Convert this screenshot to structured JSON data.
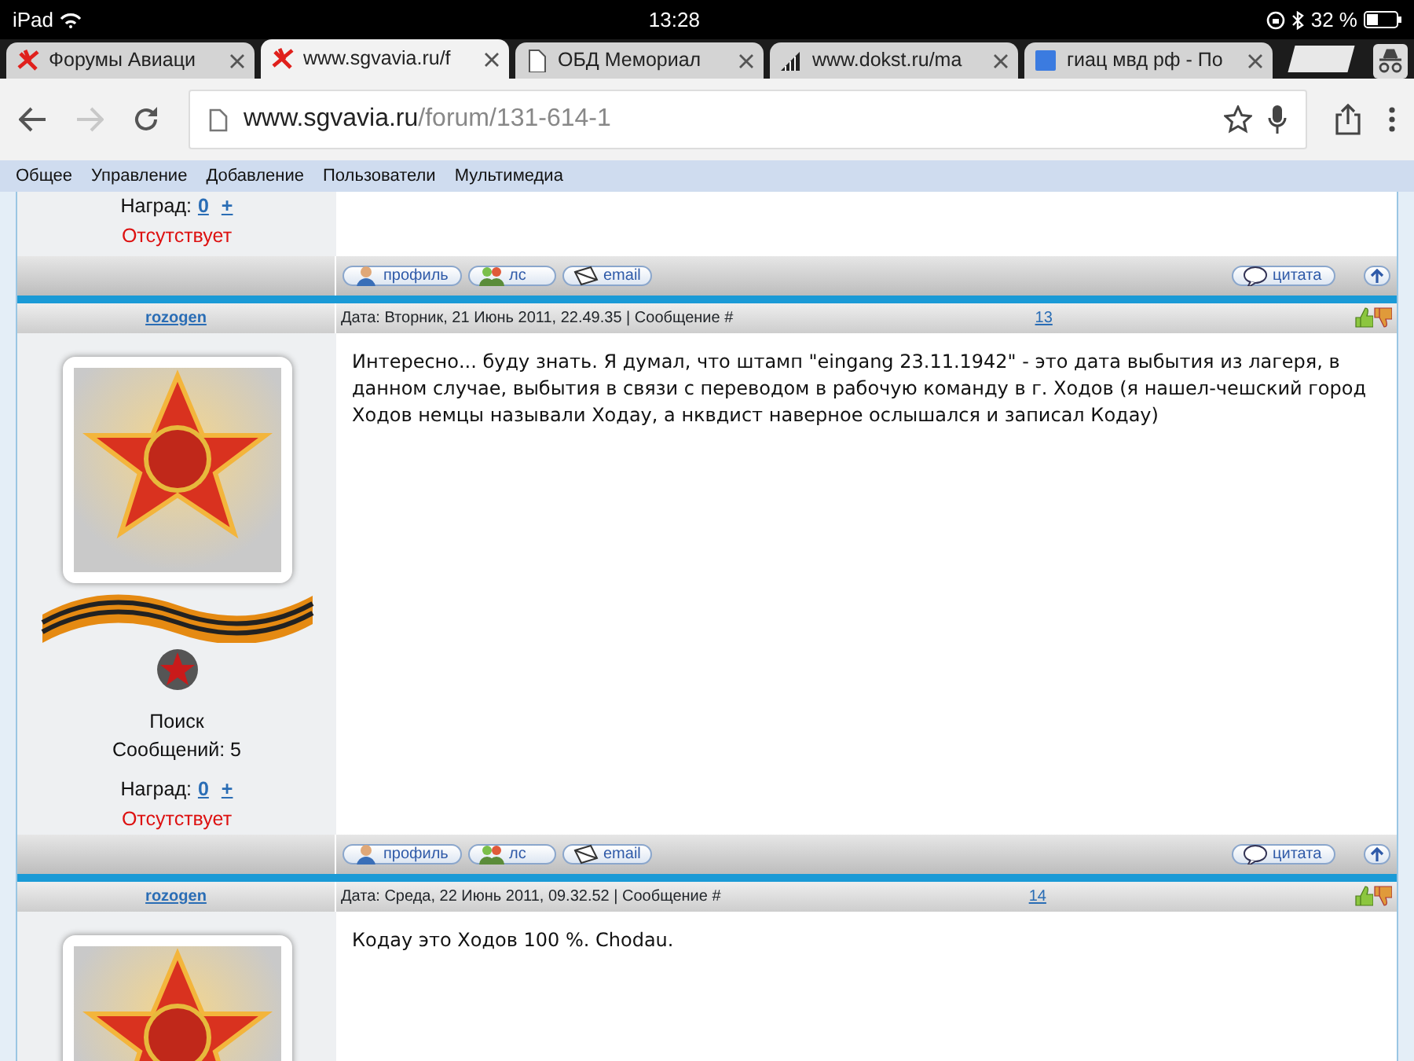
{
  "status_bar": {
    "device": "iPad",
    "time": "13:28",
    "battery": "32 %"
  },
  "tabs": [
    {
      "title": "Форумы Авиаци",
      "kind": "site",
      "selected": false
    },
    {
      "title": "www.sgvavia.ru/f",
      "kind": "site",
      "selected": true
    },
    {
      "title": "ОБД Мемориал",
      "kind": "page",
      "selected": false
    },
    {
      "title": "www.dokst.ru/ma",
      "kind": "chart",
      "selected": false
    },
    {
      "title": "гиац мвд рф - По",
      "kind": "search",
      "selected": false
    }
  ],
  "toolbar": {
    "forward_disabled": true,
    "url_host": "www.sgvavia.ru",
    "url_path": "/forum/131-614-1"
  },
  "menu": [
    "Общее",
    "Управление",
    "Добавление",
    "Пользователи",
    "Мультимедиа"
  ],
  "posts": [
    {
      "partial_top": true,
      "awards_label": "Наград:",
      "awards_count": "0",
      "awards_add": "+",
      "online_status": "Отсутствует",
      "footer_buttons": [
        "профиль",
        "лс",
        "email"
      ],
      "quote": "цитата"
    },
    {
      "author": "rozogen",
      "date": "Дата: Вторник, 21 Июнь 2011, 22.49.35 | Сообщение #",
      "number": "13",
      "text": "Интересно... буду знать. Я думал, что штамп \"eingang 23.11.1942\" - это дата выбытия из лагеря, в данном случае, выбытия в связи с переводом в рабочую команду в г. Ходов (я нашел-чешский город Ходов немцы называли Ходау, а нквдист наверное ослышался и записал Кодау)",
      "rank": "Поиск",
      "messages": "Сообщений: 5",
      "awards_label": "Наград:",
      "awards_count": "0",
      "awards_add": "+",
      "online_status": "Отсутствует",
      "footer_buttons": [
        "профиль",
        "лс",
        "email"
      ],
      "quote": "цитата"
    },
    {
      "author": "rozogen",
      "date": "Дата: Среда, 22 Июнь 2011, 09.32.52 | Сообщение #",
      "number": "14",
      "text": "Кодау это Ходов 100 %. Chodau.",
      "partial_bottom": true
    }
  ]
}
